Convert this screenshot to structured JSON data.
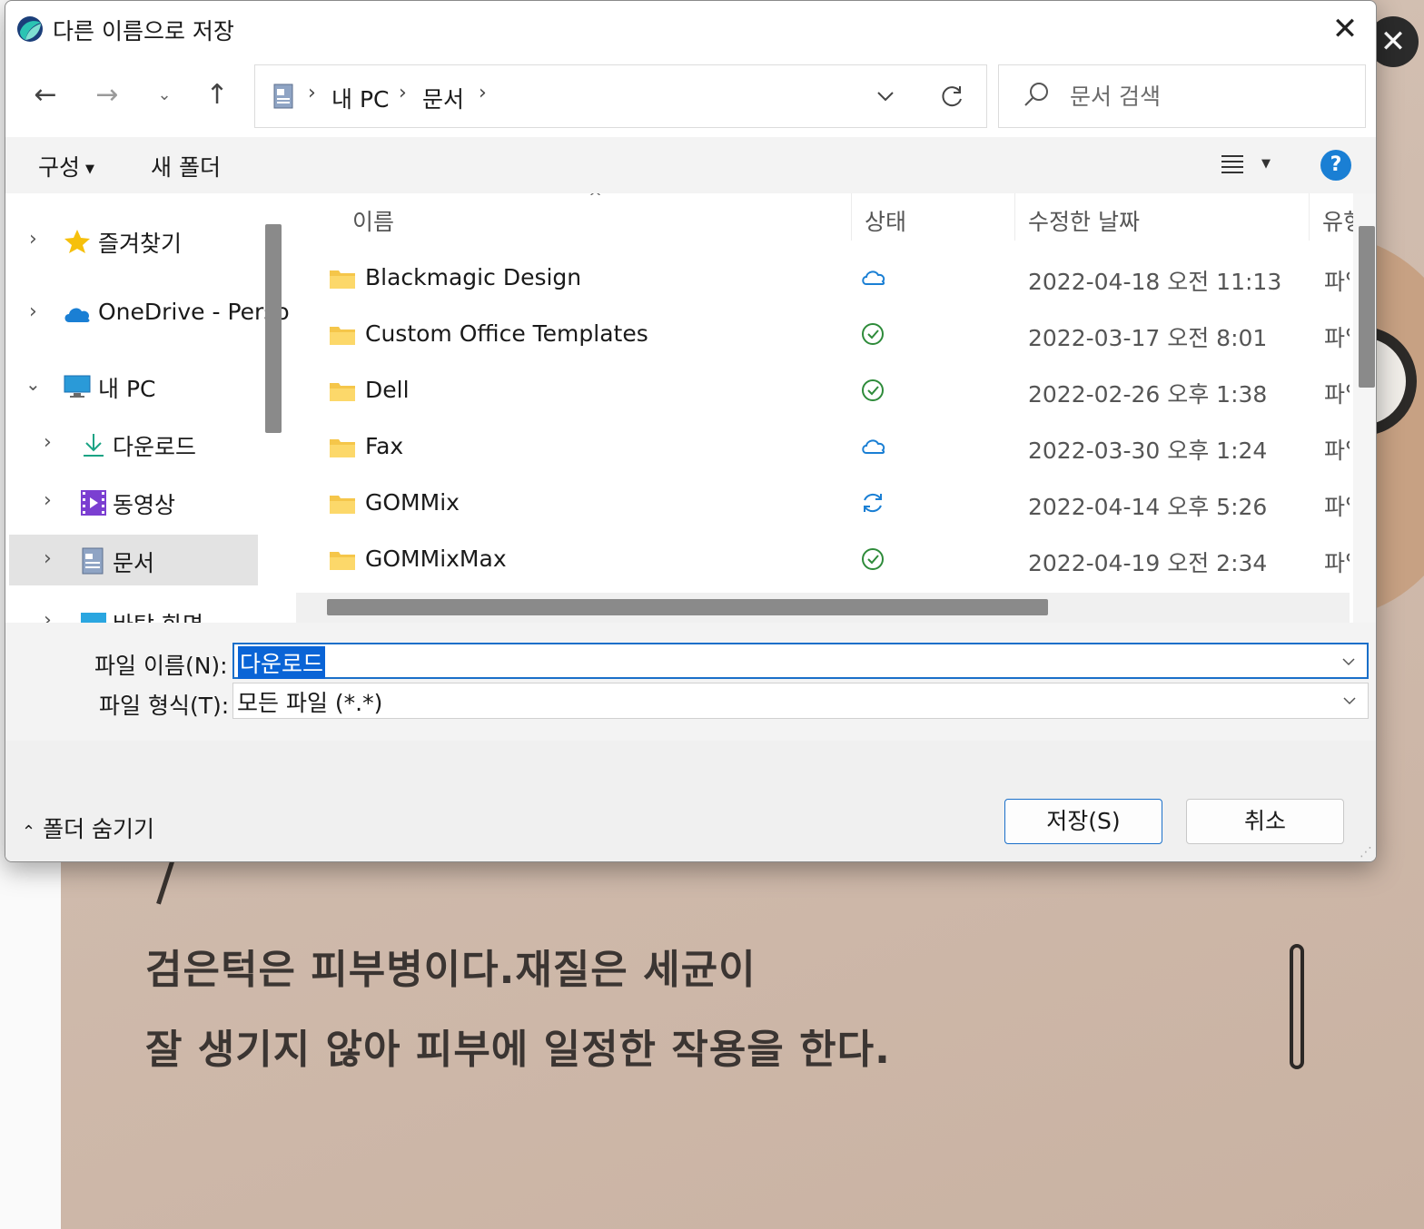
{
  "dialog": {
    "title": "다른 이름으로 저장",
    "close_label": "✕"
  },
  "nav": {
    "back_label": "←",
    "forward_label": "→",
    "recent_label": "⌄",
    "up_label": "↑"
  },
  "address": {
    "crumbs": [
      "내 PC",
      "문서"
    ],
    "separators": [
      "›",
      "›",
      "›"
    ]
  },
  "search": {
    "placeholder": "문서 검색"
  },
  "toolbar": {
    "organize_label": "구성",
    "new_folder_label": "새 폴더",
    "help_label": "?"
  },
  "tree": {
    "items": [
      {
        "label": "즐겨찾기",
        "icon": "star-icon",
        "expanded": false
      },
      {
        "label": "OneDrive - Perso",
        "icon": "cloud-icon",
        "expanded": false
      },
      {
        "label": "내 PC",
        "icon": "monitor-icon",
        "expanded": true
      },
      {
        "label": "다운로드",
        "icon": "download-icon",
        "expanded": false
      },
      {
        "label": "동영상",
        "icon": "video-icon",
        "expanded": false
      },
      {
        "label": "문서",
        "icon": "document-icon",
        "expanded": false,
        "selected": true
      },
      {
        "label": "바탕 화면",
        "icon": "desktop-icon",
        "expanded": false
      }
    ]
  },
  "columns": {
    "name": "이름",
    "status": "상태",
    "modified": "수정한 날짜",
    "type": "유형"
  },
  "files": [
    {
      "name": "Blackmagic Design",
      "status": "cloud-icon",
      "date": "2022-04-18 오전 11:13",
      "type": "파일 폴더"
    },
    {
      "name": "Custom Office Templates",
      "status": "synced-check-icon",
      "date": "2022-03-17 오전 8:01",
      "type": "파일 폴더"
    },
    {
      "name": "Dell",
      "status": "synced-check-icon",
      "date": "2022-02-26 오후 1:38",
      "type": "파일 폴더"
    },
    {
      "name": "Fax",
      "status": "cloud-icon",
      "date": "2022-03-30 오후 1:24",
      "type": "파일 폴더"
    },
    {
      "name": "GOMMix",
      "status": "syncing-icon",
      "date": "2022-04-14 오후 5:26",
      "type": "파일 폴더"
    },
    {
      "name": "GOMMixMax",
      "status": "synced-check-icon",
      "date": "2022-04-19 오전 2:34",
      "type": "파일 폴더"
    }
  ],
  "fields": {
    "filename_label": "파일 이름(N):",
    "filename_value": "다운로드",
    "filetype_label": "파일 형식(T):",
    "filetype_value": "모든 파일 (*.*)"
  },
  "footer": {
    "hide_folders_label": "폴더 숨기기",
    "save_label": "저장(S)",
    "cancel_label": "취소"
  },
  "background": {
    "line1": "검은턱은 피부병이다.재질은 세균이",
    "line2": "잘 생기지 않아 피부에 일정한 작용을 한다.",
    "close_label": "✕"
  },
  "colors": {
    "accent": "#1a6fc9",
    "selection": "#0a64d6",
    "folder": "#f5c64a",
    "cloud": "#1a7fd4",
    "check": "#2e8b3a"
  }
}
